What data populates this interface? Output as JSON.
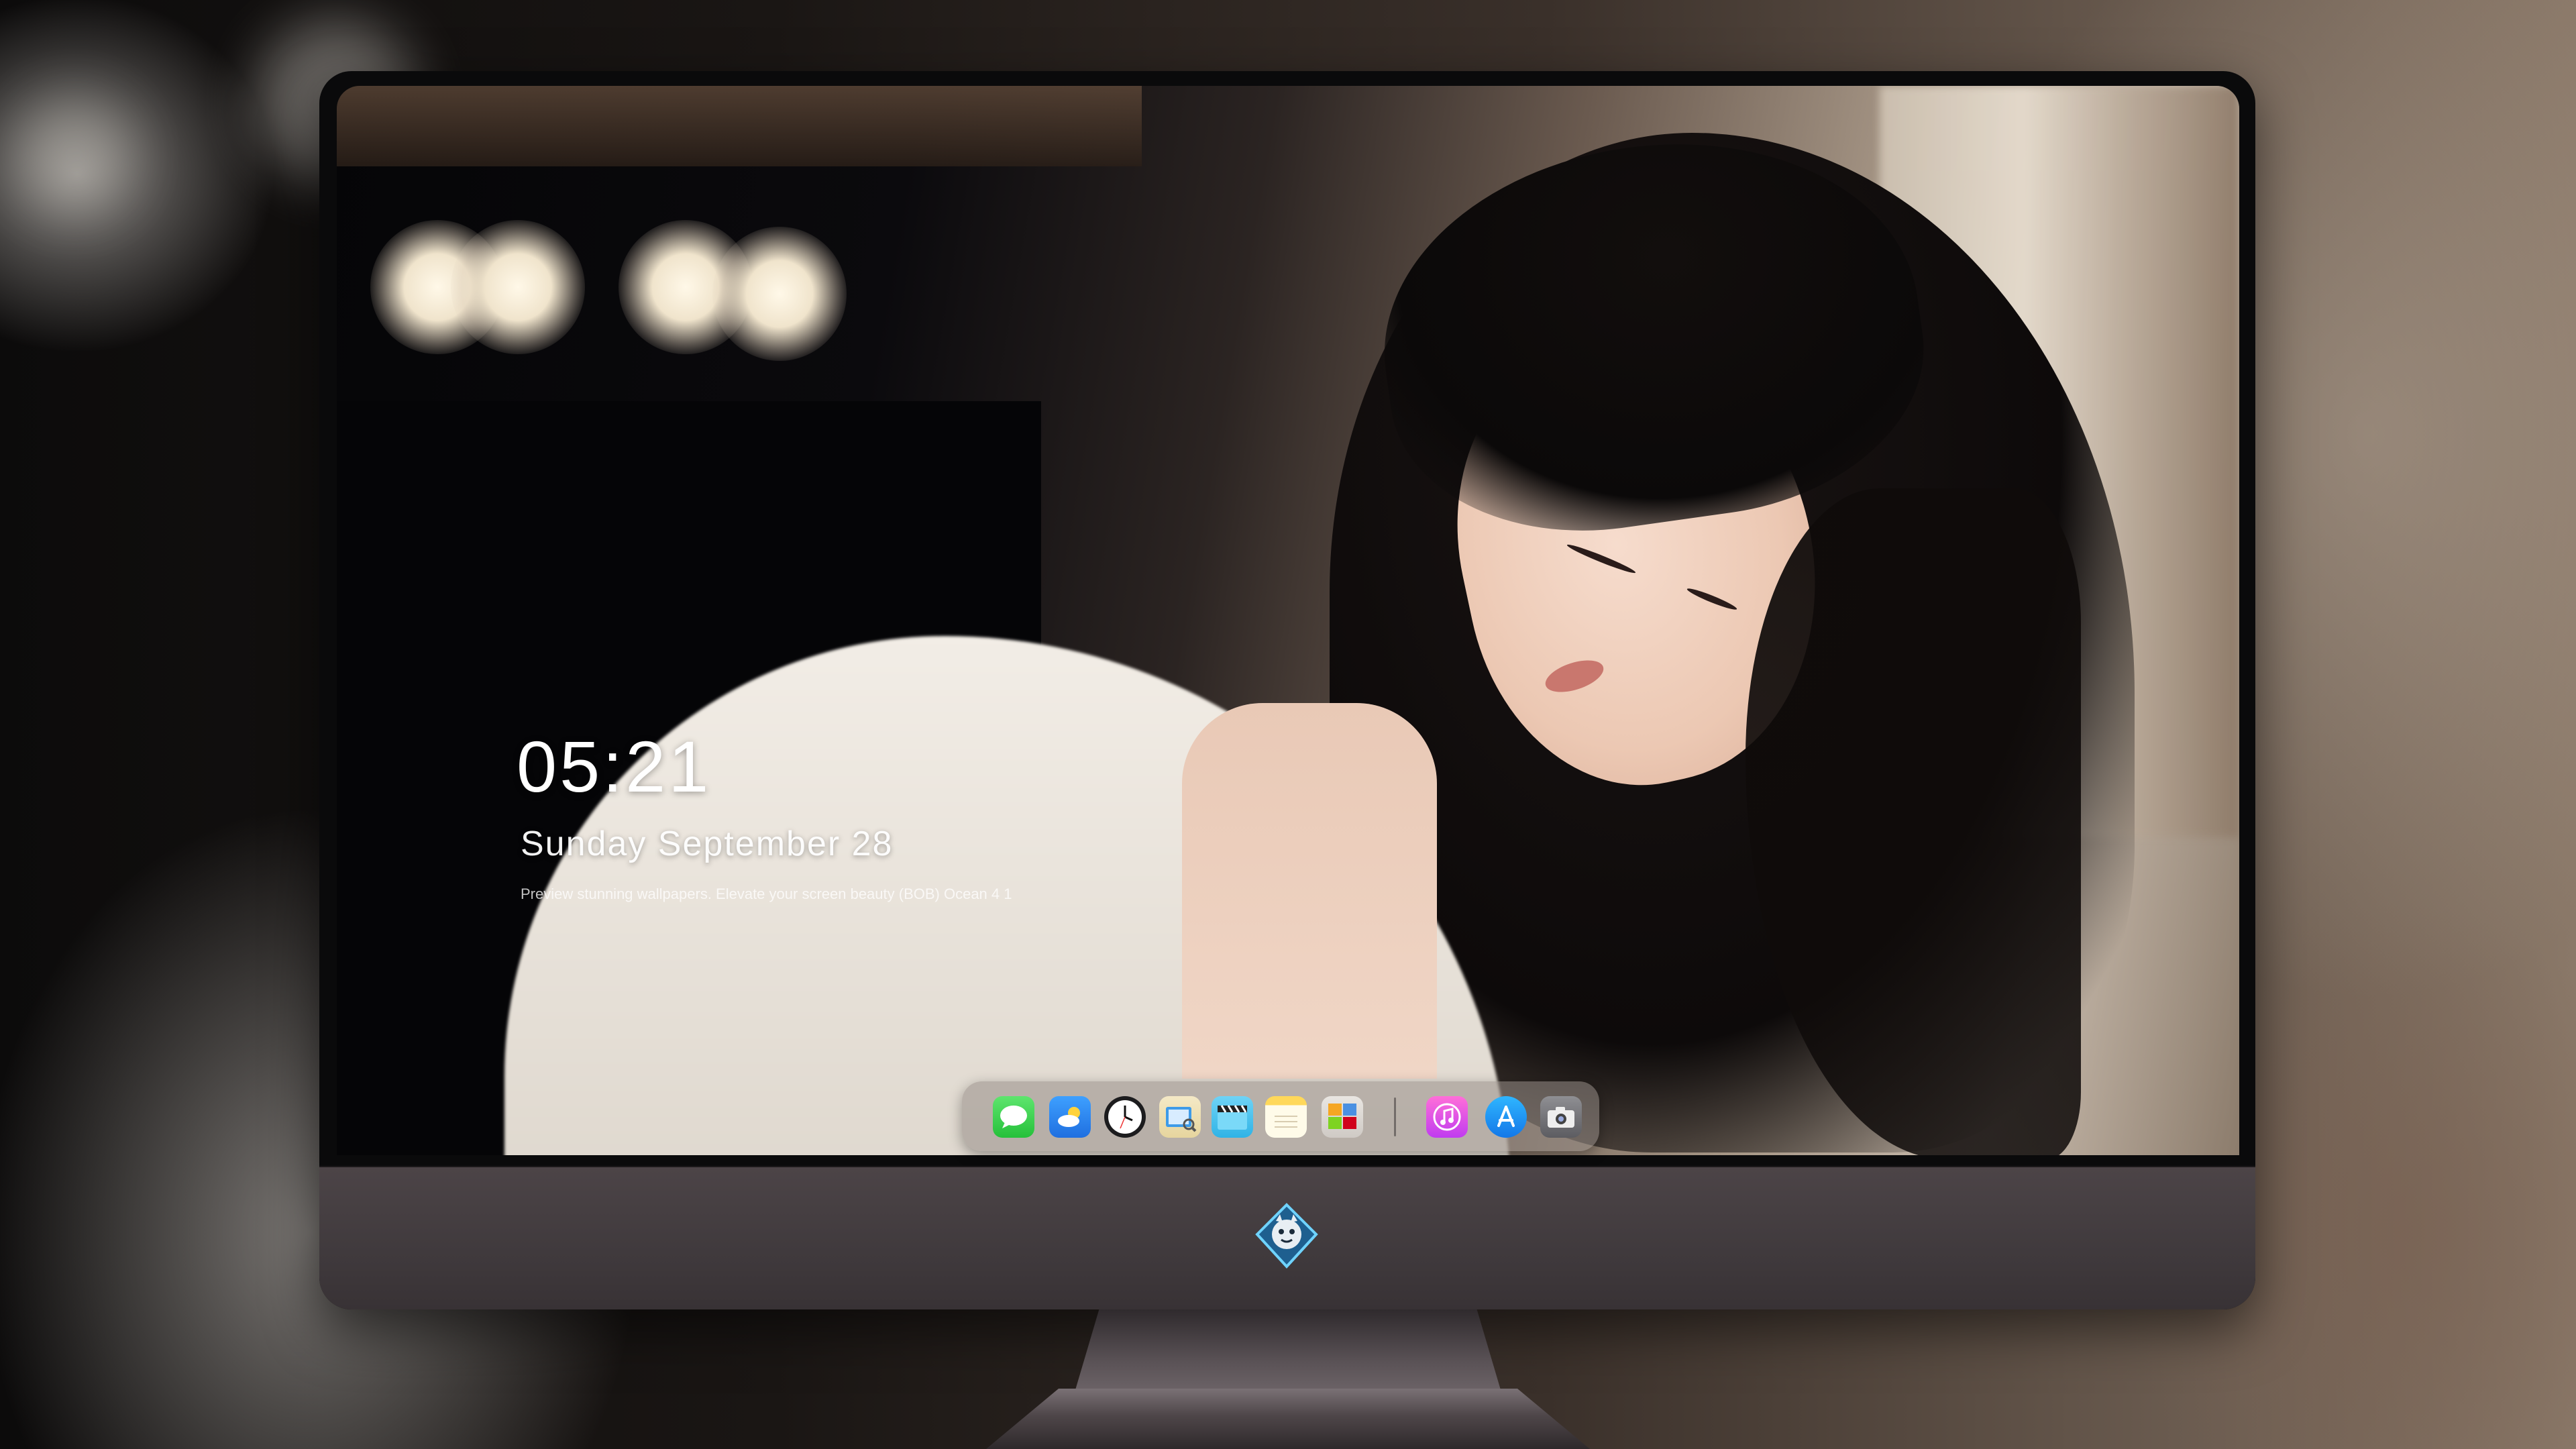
{
  "lockscreen": {
    "time": "05:21",
    "date": "Sunday  September  28",
    "tagline": "Preview stunning wallpapers. Elevate your screen beauty   (BOB)   Ocean 4 1"
  },
  "dock": {
    "apps": [
      {
        "name": "Messages",
        "icon": "messages-icon"
      },
      {
        "name": "Weather",
        "icon": "weather-icon"
      },
      {
        "name": "Clock",
        "icon": "clock-icon"
      },
      {
        "name": "Preview",
        "icon": "preview-icon"
      },
      {
        "name": "Final Cut",
        "icon": "clapper-icon"
      },
      {
        "name": "Notes",
        "icon": "notes-icon"
      },
      {
        "name": "Photo Booth",
        "icon": "photobooth-icon"
      },
      {
        "name": "Music",
        "icon": "music-icon"
      },
      {
        "name": "App Store",
        "icon": "appstore-icon"
      },
      {
        "name": "Camera",
        "icon": "camera-icon"
      }
    ]
  },
  "colors": {
    "monitor_bezel": "#0a0a0b",
    "chin": "#443d40",
    "dock_bg": "rgba(150,140,135,0.55)"
  }
}
